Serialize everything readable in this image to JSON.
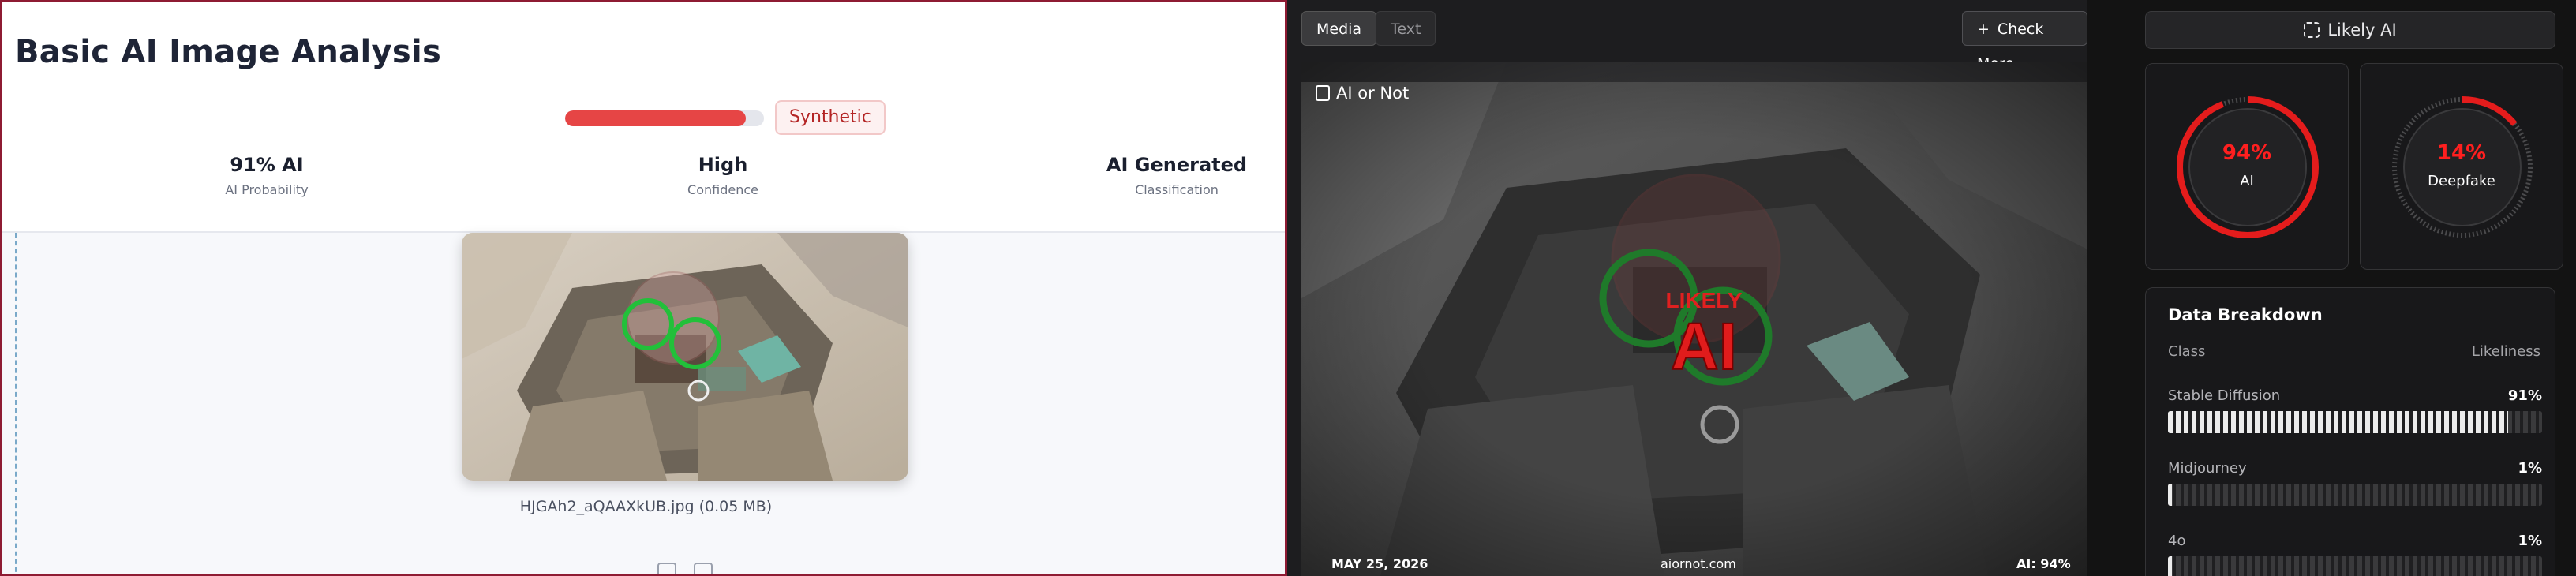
{
  "left": {
    "title": "Basic AI Image Analysis",
    "progress_fraction": 0.91,
    "pill_label": "Synthetic",
    "stats": [
      {
        "value": "91% AI",
        "label": "AI Probability"
      },
      {
        "value": "High",
        "label": "Confidence"
      },
      {
        "value": "AI Generated",
        "label": "Classification"
      }
    ],
    "filename": "HJGAh2_aQAAXkUB.jpg (0.05 MB)"
  },
  "middle": {
    "tabs": [
      {
        "label": "Media"
      },
      {
        "label": "Text"
      }
    ],
    "check_more_label": "Check More",
    "badge_label": "AI or Not",
    "overlay_line1": "LIKELY",
    "overlay_line2": "AI",
    "footer": {
      "date": "MAY 25, 2026",
      "site": "aiornot.com",
      "score": "AI: 94%"
    }
  },
  "right": {
    "header_label": "Likely AI",
    "gauges": [
      {
        "percent_text": "94%",
        "label": "AI",
        "fraction": 0.94
      },
      {
        "percent_text": "14%",
        "label": "Deepfake",
        "fraction": 0.14
      }
    ],
    "breakdown": {
      "title": "Data Breakdown",
      "col_class": "Class",
      "col_likeliness": "Likeliness",
      "rows": [
        {
          "name": "Stable Diffusion",
          "value": "91%",
          "fraction": 0.91
        },
        {
          "name": "Midjourney",
          "value": "1%",
          "fraction": 0.01
        },
        {
          "name": "4o",
          "value": "1%",
          "fraction": 0.01
        }
      ]
    }
  },
  "colors": {
    "accent_red": "#e64545",
    "gauge_red": "#ff1f1f",
    "pill_red": "#b42525",
    "circle_green": "#22c03a",
    "frame_maroon": "#8e1b33"
  },
  "icons": [
    "check-more-plus-icon",
    "aiornot-logo-icon",
    "scan-frame-icon",
    "thumbs-up-icon",
    "thumbs-down-icon"
  ]
}
